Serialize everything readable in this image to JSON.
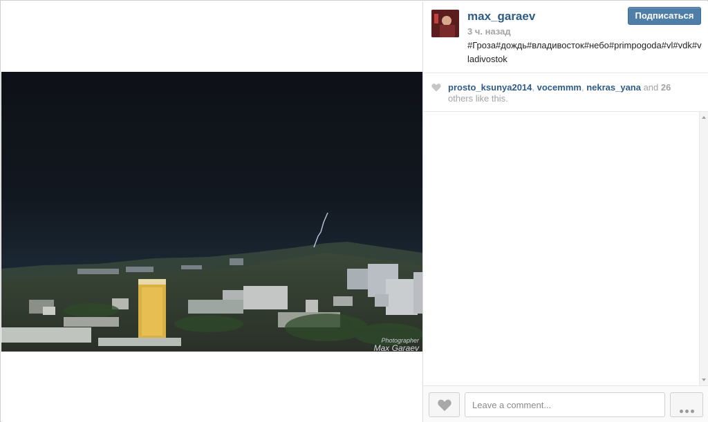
{
  "post": {
    "username": "max_garaev",
    "time_ago": "3 ч. назад",
    "caption": "#Гроза#дождь#владивосток#небо#primpogoda#vl#vdk#vladivostok",
    "follow_label": "Подписаться",
    "photo": {
      "description_icon": "photo-thunderstorm-city",
      "watermark_line1": "Photographer",
      "watermark_line2": "Max Garaev"
    }
  },
  "likes": {
    "users": [
      "prosto_ksunya2014",
      "vocemmm",
      "nekras_yana"
    ],
    "sep1": ", ",
    "sep2": ", ",
    "and_text": " and ",
    "others_count": "26",
    "others_text": "others like this."
  },
  "footer": {
    "comment_placeholder": "Leave a comment...",
    "like_icon": "heart-icon",
    "more_icon": "more-dots-icon"
  },
  "colors": {
    "link": "#2d5c88",
    "muted": "#a3a3a3",
    "follow_button": "#4f7fa8"
  }
}
